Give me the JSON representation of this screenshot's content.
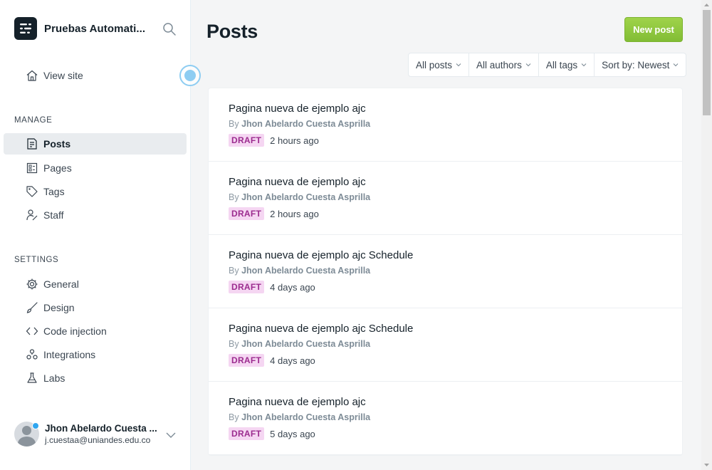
{
  "brand": {
    "title": "Pruebas Automati...",
    "logo_icon": "ghost-logo-icon"
  },
  "sidebar": {
    "view_site": "View site",
    "manage_label": "MANAGE",
    "manage_items": [
      {
        "label": "Posts",
        "icon": "posts-icon",
        "active": true
      },
      {
        "label": "Pages",
        "icon": "pages-icon"
      },
      {
        "label": "Tags",
        "icon": "tag-icon"
      },
      {
        "label": "Staff",
        "icon": "staff-icon"
      }
    ],
    "settings_label": "SETTINGS",
    "settings_items": [
      {
        "label": "General",
        "icon": "gear-icon"
      },
      {
        "label": "Design",
        "icon": "brush-icon"
      },
      {
        "label": "Code injection",
        "icon": "code-icon"
      },
      {
        "label": "Integrations",
        "icon": "integrations-icon"
      },
      {
        "label": "Labs",
        "icon": "flask-icon"
      }
    ]
  },
  "user": {
    "name": "Jhon Abelardo Cuesta ...",
    "email": "j.cuestaa@uniandes.edu.co"
  },
  "main": {
    "title": "Posts",
    "new_post": "New post",
    "filters": [
      "All posts",
      "All authors",
      "All tags",
      "Sort by: Newest"
    ]
  },
  "posts": [
    {
      "title": "Pagina nueva de ejemplo ajc",
      "by": "By",
      "author": "Jhon Abelardo Cuesta Asprilla",
      "status": "DRAFT",
      "time": "2 hours ago"
    },
    {
      "title": "Pagina nueva de ejemplo ajc",
      "by": "By",
      "author": "Jhon Abelardo Cuesta Asprilla",
      "status": "DRAFT",
      "time": "2 hours ago"
    },
    {
      "title": "Pagina nueva de ejemplo ajc Schedule",
      "by": "By",
      "author": "Jhon Abelardo Cuesta Asprilla",
      "status": "DRAFT",
      "time": "4 days ago"
    },
    {
      "title": "Pagina nueva de ejemplo ajc Schedule",
      "by": "By",
      "author": "Jhon Abelardo Cuesta Asprilla",
      "status": "DRAFT",
      "time": "4 days ago"
    },
    {
      "title": "Pagina nueva de ejemplo ajc",
      "by": "By",
      "author": "Jhon Abelardo Cuesta Asprilla",
      "status": "DRAFT",
      "time": "5 days ago"
    }
  ],
  "colors": {
    "accent_green": "#8cc63f",
    "draft_bg": "#f5d6f2",
    "draft_text": "#9c2c8f",
    "notification_dot": "#30a6ef"
  }
}
